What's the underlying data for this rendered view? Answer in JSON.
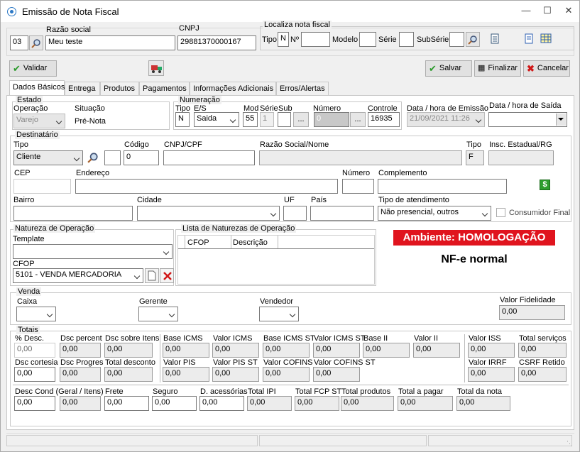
{
  "window": {
    "title": "Emissão de Nota Fiscal"
  },
  "header": {
    "code_value": "03",
    "razao_social_label": "Razão social",
    "razao_social_value": "Meu teste",
    "cnpj_label": "CNPJ",
    "cnpj_value": "29881370000167",
    "localiza_label": "Localiza nota fiscal",
    "tipo_label": "Tipo",
    "tipo_value": "N",
    "numero_label": "Nº",
    "modelo_label": "Modelo",
    "serie_label": "Série",
    "subserie_label": "SubSérie"
  },
  "toolbar": {
    "validar": "Validar",
    "salvar": "Salvar",
    "finalizar": "Finalizar",
    "cancelar": "Cancelar"
  },
  "tabs": [
    "Dados Básicos",
    "Entrega",
    "Produtos",
    "Pagamentos",
    "Informações Adicionais",
    "Erros/Alertas"
  ],
  "estado": {
    "group": "Estado",
    "operacao_label": "Operação",
    "operacao_value": "Varejo",
    "situacao_label": "Situação",
    "situacao_value": "Pré-Nota"
  },
  "numeracao": {
    "group": "Numeração",
    "tipo_label": "Tipo",
    "tipo_value": "N",
    "es_label": "E/S",
    "es_value": "Saida",
    "mod_label": "Mod",
    "mod_value": "55",
    "serie_label": "Série",
    "serie_value": "1",
    "sub_label": "Sub",
    "numero_label": "Número",
    "numero_value": "0",
    "controle_label": "Controle",
    "controle_value": "16935",
    "ellipsis": "..."
  },
  "datas": {
    "emissao_label": "Data / hora de Emissão",
    "emissao_value": "21/09/2021 11:26",
    "saida_label": "Data / hora de Saída"
  },
  "destinatario": {
    "group": "Destinatário",
    "tipo_label": "Tipo",
    "tipo_value": "Cliente",
    "codigo_label": "Código",
    "codigo_value": "0",
    "cnpjcpf_label": "CNPJ/CPF",
    "razao_label": "Razão Social/Nome",
    "tipo2_label": "Tipo",
    "tipo2_value": "F",
    "inscricao_label": "Insc. Estadual/RG",
    "cep_label": "CEP",
    "endereco_label": "Endereço",
    "numero_label": "Número",
    "complemento_label": "Complemento",
    "bairro_label": "Bairro",
    "cidade_label": "Cidade",
    "uf_label": "UF",
    "pais_label": "País",
    "atendimento_label": "Tipo de atendimento",
    "atendimento_value": "Não presencial, outros",
    "consumidor_label": "Consumidor Final"
  },
  "natureza": {
    "group": "Natureza de Operação",
    "template_label": "Template",
    "cfop_label": "CFOP",
    "cfop_value": "5101  - VENDA MERCADORIA",
    "lista_group": "Lista de Naturezas de Operação",
    "col_cfop": "CFOP",
    "col_descricao": "Descrição"
  },
  "ambiente": {
    "banner": "Ambiente: HOMOLOGAÇÃO",
    "tipo_nfe": "NF-e normal",
    "banner_color": "#e0141e"
  },
  "venda": {
    "group": "Venda",
    "caixa_label": "Caixa",
    "gerente_label": "Gerente",
    "vendedor_label": "Vendedor",
    "fidelidade_label": "Valor Fidelidade",
    "fidelidade_value": "0,00"
  },
  "totais": {
    "group": "Totais",
    "row1": [
      {
        "label": "% Desc.",
        "value": "0,00"
      },
      {
        "label": "Dsc percent",
        "value": "0,00"
      },
      {
        "label": "Dsc sobre Itens",
        "value": "0,00"
      },
      {
        "label": "Base ICMS",
        "value": "0,00"
      },
      {
        "label": "Valor ICMS",
        "value": "0,00"
      },
      {
        "label": "Base ICMS ST",
        "value": "0,00"
      },
      {
        "label": "Valor ICMS ST",
        "value": "0,00"
      },
      {
        "label": "Base II",
        "value": "0,00"
      },
      {
        "label": "Valor II",
        "value": "0,00"
      },
      {
        "label": "Valor ISS",
        "value": "0,00"
      },
      {
        "label": "Total serviços",
        "value": "0,00"
      }
    ],
    "row2": [
      {
        "label": "Dsc cortesia",
        "value": "0,00"
      },
      {
        "label": "Dsc Progres",
        "value": "0,00"
      },
      {
        "label": "Total desconto",
        "value": "0,00"
      },
      {
        "label": "Valor PIS",
        "value": "0,00"
      },
      {
        "label": "Valor PIS ST",
        "value": "0,00"
      },
      {
        "label": "Valor COFINS",
        "value": "0,00"
      },
      {
        "label": "Valor COFINS ST",
        "value": "0,00"
      },
      {
        "label": "Valor IRRF",
        "value": "0,00"
      },
      {
        "label": "CSRF Retido",
        "value": "0,00"
      }
    ],
    "row3": [
      {
        "label": "Desc Cond (Geral / Itens)",
        "value": "0,00"
      },
      {
        "label": "",
        "value": "0,00"
      },
      {
        "label": "Frete",
        "value": "0,00"
      },
      {
        "label": "Seguro",
        "value": "0,00"
      },
      {
        "label": "D. acessórias",
        "value": "0,00"
      },
      {
        "label": "Total IPI",
        "value": "0,00"
      },
      {
        "label": "Total FCP ST",
        "value": "0,00"
      },
      {
        "label": "Total produtos",
        "value": "0,00"
      },
      {
        "label": "Total a pagar",
        "value": "0,00"
      },
      {
        "label": "Total da nota",
        "value": "0,00"
      }
    ]
  }
}
